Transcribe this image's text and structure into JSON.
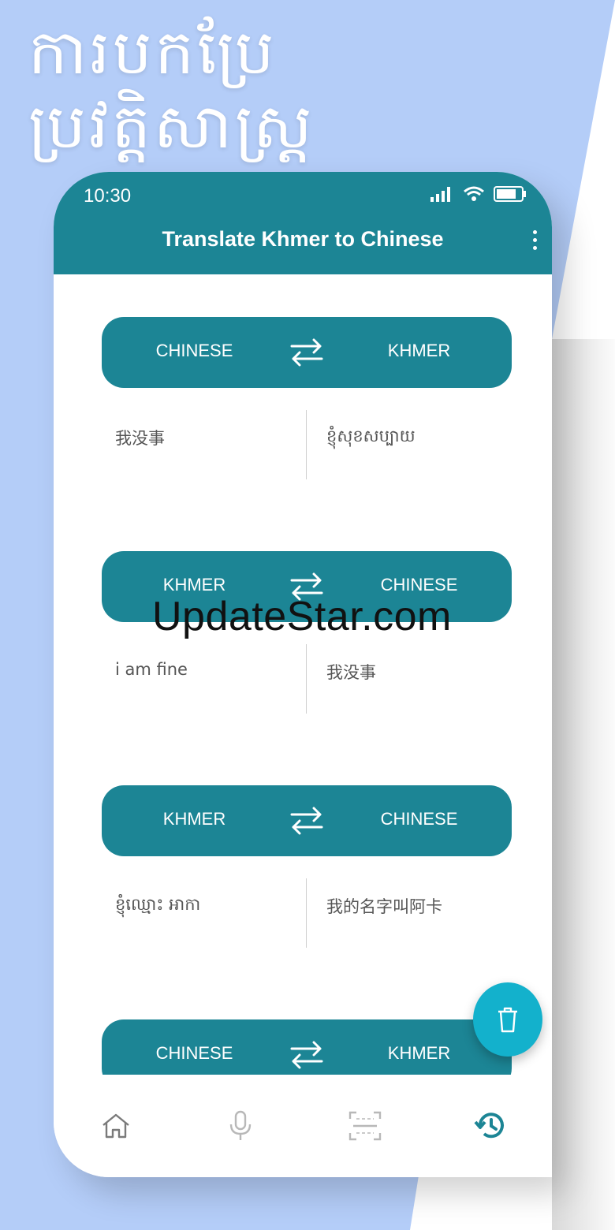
{
  "headline": {
    "line1": "ការបកប្រែ",
    "line2": "ប្រវត្តិសាស្ត្រ"
  },
  "status_bar": {
    "time": "10:30"
  },
  "appbar": {
    "title": "Translate Khmer to Chinese"
  },
  "history": [
    {
      "source_lang": "CHINESE",
      "target_lang": "KHMER",
      "source_text": "我没事",
      "target_text": "ខ្ញុំសុខសប្បាយ"
    },
    {
      "source_lang": "KHMER",
      "target_lang": "CHINESE",
      "source_text": "i am fine",
      "target_text": "我没事"
    },
    {
      "source_lang": "KHMER",
      "target_lang": "CHINESE",
      "source_text": "ខ្ញុំឈ្មោះ អាកា",
      "target_text": "我的名字叫阿卡"
    },
    {
      "source_lang": "CHINESE",
      "target_lang": "KHMER",
      "source_text": "",
      "target_text": ""
    }
  ],
  "bottom_nav": [
    "home-icon",
    "microphone-icon",
    "scan-icon",
    "history-icon"
  ],
  "watermark": "UpdateStar.com",
  "colors": {
    "accent": "#1c8595",
    "fab": "#13b1cc",
    "background": "#b4cdf8"
  }
}
